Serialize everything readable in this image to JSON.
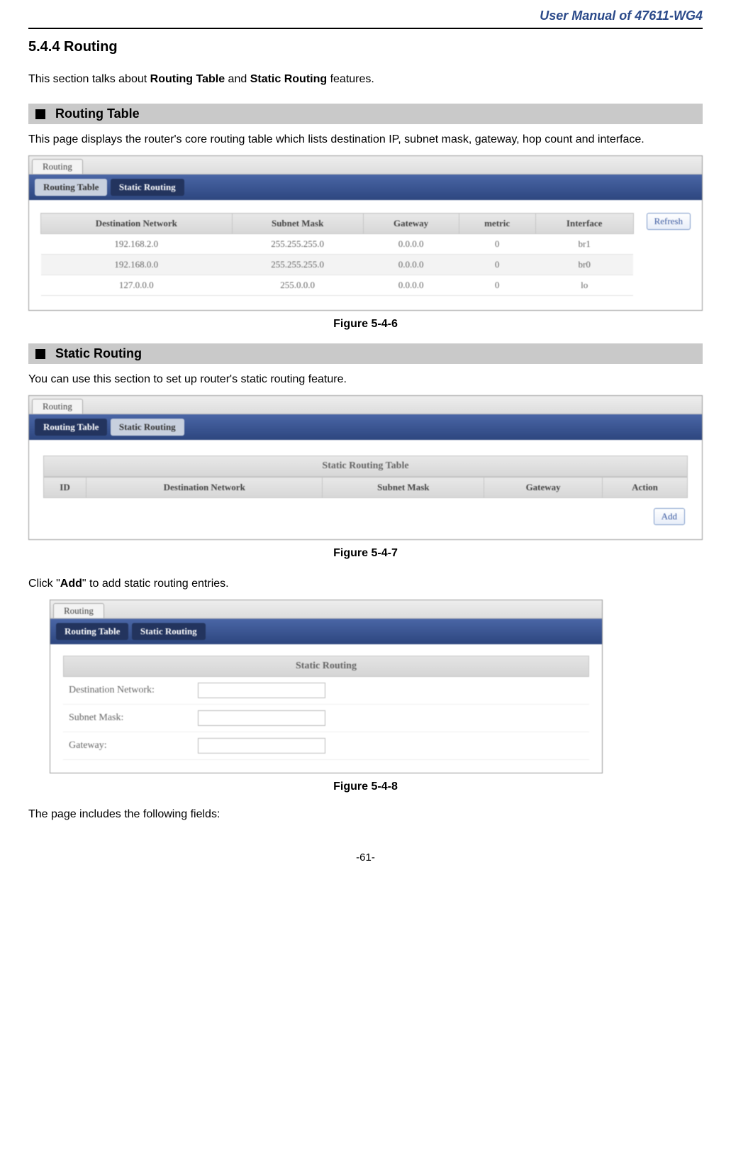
{
  "header": {
    "doc_title": "User Manual of 47611-WG4"
  },
  "section": {
    "number_title": "5.4.4  Routing"
  },
  "intro": {
    "pre": "This section talks about ",
    "b1": "Routing Table",
    "mid": " and ",
    "b2": "Static Routing",
    "post": " features."
  },
  "routing_table": {
    "heading": "Routing Table",
    "desc": "This page displays the router's core routing table which lists destination IP, subnet mask, gateway, hop count and interface."
  },
  "fig1": {
    "top_tab": "Routing",
    "nav_active": "Routing Table",
    "nav_inactive": "Static Routing",
    "headers": {
      "c1": "Destination Network",
      "c2": "Subnet Mask",
      "c3": "Gateway",
      "c4": "metric",
      "c5": "Interface"
    },
    "rows": [
      {
        "c1": "192.168.2.0",
        "c2": "255.255.255.0",
        "c3": "0.0.0.0",
        "c4": "0",
        "c5": "br1"
      },
      {
        "c1": "192.168.0.0",
        "c2": "255.255.255.0",
        "c3": "0.0.0.0",
        "c4": "0",
        "c5": "br0"
      },
      {
        "c1": "127.0.0.0",
        "c2": "255.0.0.0",
        "c3": "0.0.0.0",
        "c4": "0",
        "c5": "lo"
      }
    ],
    "refresh": "Refresh",
    "caption": "Figure 5-4-6"
  },
  "static_routing": {
    "heading": "Static Routing",
    "desc": "You can use this section to set up router's static routing feature."
  },
  "fig2": {
    "top_tab": "Routing",
    "nav_active": "Routing Table",
    "nav_inactive": "Static Routing",
    "title": "Static Routing Table",
    "headers": {
      "c1": "ID",
      "c2": "Destination Network",
      "c3": "Subnet Mask",
      "c4": "Gateway",
      "c5": "Action"
    },
    "add": "Add",
    "caption": "Figure 5-4-7"
  },
  "fig3_intro": {
    "pre": "Click \"",
    "b": "Add",
    "post": "\" to add static routing entries."
  },
  "fig3": {
    "top_tab": "Routing",
    "nav_a": "Routing Table",
    "nav_b": "Static Routing",
    "title": "Static Routing",
    "labels": {
      "dest": "Destination Network:",
      "mask": "Subnet Mask:",
      "gw": "Gateway:"
    },
    "caption": "Figure 5-4-8"
  },
  "outro": "The page includes the following fields:",
  "footer": {
    "page": "-61-"
  }
}
